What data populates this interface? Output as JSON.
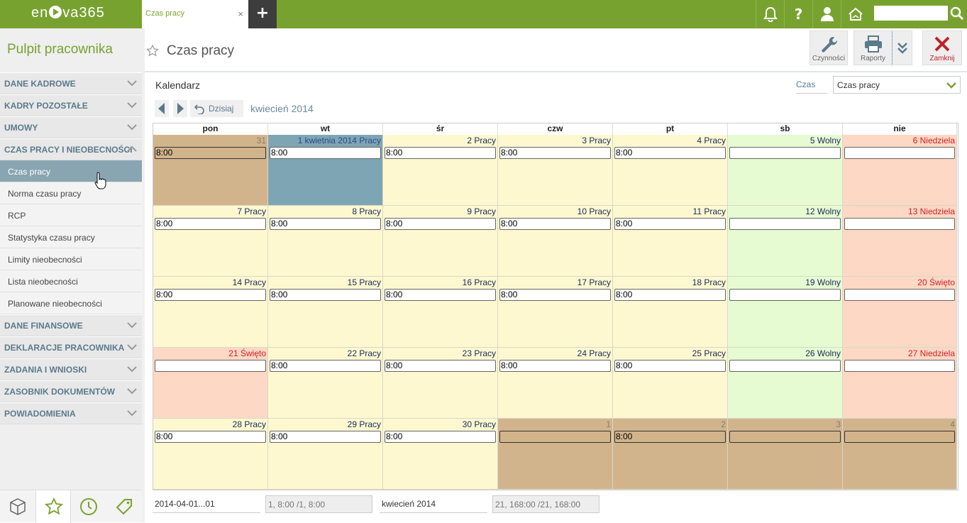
{
  "app": {
    "logo": "en▶va365",
    "logo_parts": [
      "en",
      "va365"
    ]
  },
  "tabs": [
    {
      "label": "Czas pracy",
      "close": "×"
    }
  ],
  "tab_add": "+",
  "topbar_icons": [
    "bell-icon",
    "help-icon",
    "user-icon",
    "home-icon"
  ],
  "topbar_help": "?",
  "search": {
    "value": "",
    "placeholder": ""
  },
  "sidebar": {
    "title": "Pulpit pracownika",
    "sections": [
      {
        "label": "DANE KADROWE",
        "expanded": false
      },
      {
        "label": "KADRY POZOSTAŁE",
        "expanded": false
      },
      {
        "label": "UMOWY",
        "expanded": false
      },
      {
        "label": "CZAS PRACY I NIEOBECNOŚCI",
        "expanded": true,
        "items": [
          "Czas pracy",
          "Norma czasu pracy",
          "RCP",
          "Statystyka czasu pracy",
          "Limity nieobecności",
          "Lista nieobecności",
          "Planowane nieobecności"
        ],
        "active": "Czas pracy"
      },
      {
        "label": "DANE FINANSOWE",
        "expanded": false
      },
      {
        "label": "DEKLARACJE PRACOWNIKA",
        "expanded": false
      },
      {
        "label": "ZADANIA I WNIOSKI",
        "expanded": false
      },
      {
        "label": "ZASOBNIK DOKUMENTÓW",
        "expanded": false
      },
      {
        "label": "POWIADOMIENIA",
        "expanded": false
      }
    ],
    "bottom_icons": [
      "box-icon",
      "star-icon",
      "clock-icon",
      "tag-icon"
    ]
  },
  "page": {
    "title": "Czas pracy"
  },
  "toolbar": {
    "czynnosci": "Czynności",
    "raporty": "Raporty",
    "zamknij": "Zamknij",
    "colors": {
      "close": "#c0202a",
      "accent": "#78a22f"
    }
  },
  "calendar": {
    "label": "Kalendarz",
    "czas_label": "Czas",
    "czas_value": "Czas pracy",
    "today_label": "Dzisiaj",
    "month": "kwiecień 2014",
    "day_headers": [
      "pon",
      "wt",
      "śr",
      "czw",
      "pt",
      "sb",
      "nie"
    ],
    "weeks": [
      [
        {
          "label": "31",
          "type": "out",
          "time": "8:00"
        },
        {
          "label": "1 kwietnia 2014 Pracy",
          "type": "today",
          "time": "8:00"
        },
        {
          "label": "2 Pracy",
          "type": "work",
          "time": "8:00"
        },
        {
          "label": "3 Pracy",
          "type": "work",
          "time": "8:00"
        },
        {
          "label": "4 Pracy",
          "type": "work",
          "time": "8:00"
        },
        {
          "label": "5 Wolny",
          "type": "free",
          "time": ""
        },
        {
          "label": "6 Niedziela",
          "type": "sun",
          "time": ""
        }
      ],
      [
        {
          "label": "7 Pracy",
          "type": "work",
          "time": "8:00"
        },
        {
          "label": "8 Pracy",
          "type": "work",
          "time": "8:00"
        },
        {
          "label": "9 Pracy",
          "type": "work",
          "time": "8:00"
        },
        {
          "label": "10 Pracy",
          "type": "work",
          "time": "8:00"
        },
        {
          "label": "11 Pracy",
          "type": "work",
          "time": "8:00"
        },
        {
          "label": "12 Wolny",
          "type": "free",
          "time": ""
        },
        {
          "label": "13 Niedziela",
          "type": "sun",
          "time": ""
        }
      ],
      [
        {
          "label": "14 Pracy",
          "type": "work",
          "time": "8:00"
        },
        {
          "label": "15 Pracy",
          "type": "work",
          "time": "8:00"
        },
        {
          "label": "16 Pracy",
          "type": "work",
          "time": "8:00"
        },
        {
          "label": "17 Pracy",
          "type": "work",
          "time": "8:00"
        },
        {
          "label": "18 Pracy",
          "type": "work",
          "time": "8:00"
        },
        {
          "label": "19 Wolny",
          "type": "free",
          "time": ""
        },
        {
          "label": "20 Święto",
          "type": "sun",
          "time": ""
        }
      ],
      [
        {
          "label": "21 Święto",
          "type": "sun",
          "time": ""
        },
        {
          "label": "22 Pracy",
          "type": "work",
          "time": "8:00"
        },
        {
          "label": "23 Pracy",
          "type": "work",
          "time": "8:00"
        },
        {
          "label": "24 Pracy",
          "type": "work",
          "time": "8:00"
        },
        {
          "label": "25 Pracy",
          "type": "work",
          "time": "8:00"
        },
        {
          "label": "26 Wolny",
          "type": "free",
          "time": ""
        },
        {
          "label": "27 Niedziela",
          "type": "sun",
          "time": ""
        }
      ],
      [
        {
          "label": "28 Pracy",
          "type": "work",
          "time": "8:00"
        },
        {
          "label": "29 Pracy",
          "type": "work",
          "time": "8:00"
        },
        {
          "label": "30 Pracy",
          "type": "work",
          "time": "8:00"
        },
        {
          "label": "1",
          "type": "out",
          "time": ""
        },
        {
          "label": "2",
          "type": "out",
          "time": "8:00"
        },
        {
          "label": "3",
          "type": "out",
          "time": ""
        },
        {
          "label": "4",
          "type": "out",
          "time": ""
        }
      ]
    ]
  },
  "footer": {
    "period": "2014-04-01...01",
    "summary1": "1, 8:00 /1, 8:00",
    "month": "kwiecień 2014",
    "summary2": "21, 168:00 /21, 168:00"
  }
}
